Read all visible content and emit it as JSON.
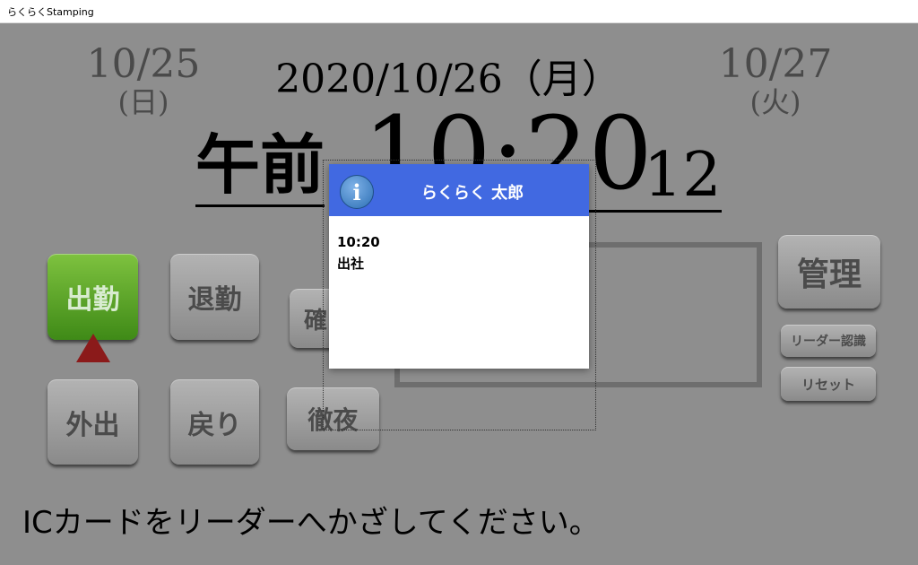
{
  "window": {
    "title": "らくらくStamping"
  },
  "dates": {
    "prev_date": "10/25",
    "prev_weekday": "(日)",
    "today": "2020/10/26（月）",
    "next_date": "10/27",
    "next_weekday": "(火)"
  },
  "clock": {
    "ampm": "午前",
    "time": "10:20",
    "seconds": "12"
  },
  "buttons": {
    "clock_in": "出勤",
    "clock_out": "退勤",
    "confirm": "確",
    "go_out": "外出",
    "return": "戻り",
    "all_night": "徹夜",
    "admin": "管理",
    "reader_auth": "リーダー認識",
    "reset": "リセット"
  },
  "status_message": "ICカードをリーダーへかざしてください。",
  "dialog": {
    "title": "らくらく 太郎",
    "time": "10:20",
    "action": "出社",
    "icon": "info-icon"
  },
  "colors": {
    "dialog_header": "#4169e1",
    "clock_in_active": "#5a9e2a",
    "selected_marker": "#8b1a1a",
    "background": "#8e8e8e"
  }
}
